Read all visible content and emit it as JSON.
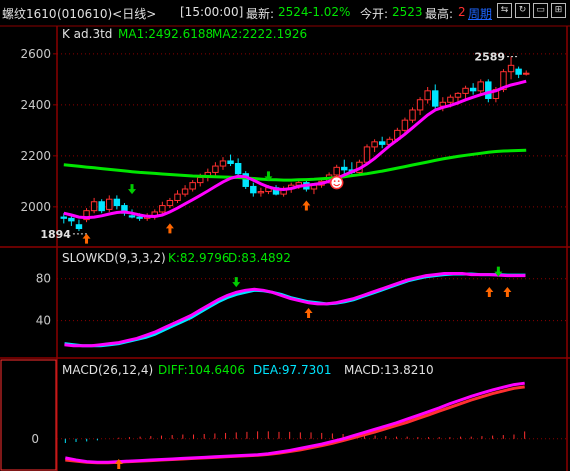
{
  "header": {
    "symbol": "螺纹1610",
    "code_period": "(010610)<日线>",
    "time": "[15:00:00]",
    "latest_label": "最新:",
    "latest_value": "2524",
    "change": "-1.02%",
    "open_label": "今开:",
    "open_value": "2523",
    "high_label": "最高:",
    "high_value": "2",
    "period_link": "周期",
    "nav_buttons": [
      "⇆",
      "↻",
      "▭",
      "⊞"
    ]
  },
  "colors": {
    "background": "#000000",
    "up": "#ff3030",
    "down": "#00e6ff",
    "ma1": "#ff00ff",
    "ma2": "#00e600",
    "slow_line": "#ee1111",
    "grid": "#8b0000",
    "axis_text": "#c8c8c8",
    "signal_up": "#ff6600",
    "signal_down": "#00cc00",
    "neg_value": "#00e600",
    "pos_value": "#ff3030",
    "link": "#1e66ff"
  },
  "chart_data": [
    {
      "type": "candlestick",
      "title": "K  ad.3td",
      "indicators": [
        {
          "label": "MA1:",
          "value": "2492.6188"
        },
        {
          "label": "MA2:",
          "value": "2222.1926"
        }
      ],
      "ylim": [
        1870,
        2670
      ],
      "y_ticks": [
        "2600",
        "2400",
        "2200",
        "2000"
      ],
      "y_tick_values": [
        2600,
        2400,
        2200,
        2000
      ],
      "annotations": [
        {
          "text": "1894",
          "value": 1894
        },
        {
          "text": "2589",
          "value": 2589
        }
      ],
      "candles": [
        [
          1960,
          1975,
          1935,
          1955
        ],
        [
          1955,
          1965,
          1925,
          1945
        ],
        [
          1930,
          1950,
          1905,
          1915
        ],
        [
          1950,
          1995,
          1940,
          1985
        ],
        [
          1985,
          2035,
          1975,
          2020
        ],
        [
          2020,
          2030,
          1975,
          1985
        ],
        [
          1990,
          2045,
          1980,
          2030
        ],
        [
          2030,
          2045,
          1990,
          2005
        ],
        [
          2005,
          2015,
          1965,
          1975
        ],
        [
          1965,
          1990,
          1955,
          1960
        ],
        [
          1960,
          1975,
          1945,
          1955
        ],
        [
          1955,
          1975,
          1945,
          1960
        ],
        [
          1960,
          1990,
          1950,
          1980
        ],
        [
          1980,
          2020,
          1970,
          2005
        ],
        [
          2005,
          2035,
          1995,
          2025
        ],
        [
          2025,
          2065,
          2015,
          2050
        ],
        [
          2050,
          2085,
          2040,
          2070
        ],
        [
          2070,
          2105,
          2060,
          2095
        ],
        [
          2095,
          2130,
          2080,
          2115
        ],
        [
          2115,
          2150,
          2100,
          2135
        ],
        [
          2135,
          2175,
          2120,
          2160
        ],
        [
          2160,
          2195,
          2145,
          2180
        ],
        [
          2180,
          2205,
          2160,
          2170
        ],
        [
          2170,
          2190,
          2120,
          2130
        ],
        [
          2130,
          2140,
          2070,
          2080
        ],
        [
          2080,
          2095,
          2040,
          2055
        ],
        [
          2055,
          2075,
          2040,
          2060
        ],
        [
          2060,
          2085,
          2050,
          2075
        ],
        [
          2075,
          2085,
          2045,
          2050
        ],
        [
          2050,
          2080,
          2040,
          2070
        ],
        [
          2070,
          2095,
          2055,
          2085
        ],
        [
          2085,
          2110,
          2070,
          2095
        ],
        [
          2095,
          2110,
          2060,
          2070
        ],
        [
          2070,
          2090,
          2050,
          2085
        ],
        [
          2085,
          2115,
          2075,
          2100
        ],
        [
          2100,
          2135,
          2090,
          2125
        ],
        [
          2125,
          2165,
          2115,
          2155
        ],
        [
          2155,
          2185,
          2130,
          2145
        ],
        [
          2145,
          2175,
          2120,
          2135
        ],
        [
          2135,
          2185,
          2125,
          2175
        ],
        [
          2175,
          2245,
          2165,
          2235
        ],
        [
          2235,
          2265,
          2215,
          2255
        ],
        [
          2255,
          2275,
          2230,
          2245
        ],
        [
          2245,
          2275,
          2235,
          2265
        ],
        [
          2265,
          2310,
          2255,
          2300
        ],
        [
          2300,
          2350,
          2290,
          2340
        ],
        [
          2340,
          2390,
          2330,
          2380
        ],
        [
          2380,
          2430,
          2360,
          2420
        ],
        [
          2420,
          2470,
          2405,
          2455
        ],
        [
          2455,
          2480,
          2380,
          2395
        ],
        [
          2395,
          2430,
          2375,
          2410
        ],
        [
          2410,
          2440,
          2390,
          2430
        ],
        [
          2430,
          2450,
          2400,
          2445
        ],
        [
          2445,
          2475,
          2425,
          2465
        ],
        [
          2465,
          2485,
          2440,
          2455
        ],
        [
          2455,
          2500,
          2440,
          2490
        ],
        [
          2490,
          2500,
          2410,
          2425
        ],
        [
          2425,
          2470,
          2410,
          2460
        ],
        [
          2460,
          2540,
          2450,
          2530
        ],
        [
          2530,
          2589,
          2500,
          2555
        ],
        [
          2540,
          2550,
          2505,
          2520
        ],
        [
          2523,
          2535,
          2515,
          2524
        ]
      ],
      "ma1": [
        1975,
        1968,
        1960,
        1958,
        1960,
        1965,
        1972,
        1978,
        1980,
        1975,
        1968,
        1963,
        1962,
        1968,
        1980,
        1995,
        2012,
        2028,
        2045,
        2062,
        2080,
        2098,
        2112,
        2120,
        2118,
        2105,
        2090,
        2078,
        2070,
        2068,
        2072,
        2080,
        2085,
        2088,
        2092,
        2100,
        2112,
        2125,
        2138,
        2150,
        2168,
        2190,
        2215,
        2240,
        2262,
        2285,
        2310,
        2335,
        2360,
        2380,
        2390,
        2398,
        2408,
        2420,
        2430,
        2440,
        2448,
        2455,
        2468,
        2478,
        2485,
        2492.6
      ],
      "ma2": [
        2165,
        2162,
        2159,
        2156,
        2153,
        2150,
        2147,
        2144,
        2141,
        2138,
        2135,
        2133,
        2131,
        2129,
        2127,
        2125,
        2123,
        2121,
        2120,
        2119,
        2118,
        2117,
        2116,
        2115,
        2113,
        2111,
        2109,
        2107,
        2106,
        2105,
        2105,
        2106,
        2107,
        2108,
        2110,
        2112,
        2115,
        2118,
        2122,
        2126,
        2130,
        2135,
        2140,
        2146,
        2152,
        2158,
        2164,
        2170,
        2176,
        2182,
        2188,
        2193,
        2198,
        2202,
        2206,
        2210,
        2214,
        2217,
        2219,
        2220,
        2221,
        2222.2
      ]
    },
    {
      "type": "line",
      "title": "SLOWKD(9,3,3,2)",
      "indicators": [
        {
          "label": "K:",
          "value": "82.9796"
        },
        {
          "label": "D:",
          "value": "83.4892"
        }
      ],
      "ylim": [
        10,
        96
      ],
      "y_ticks": [
        "80",
        "40"
      ],
      "y_tick_values": [
        80,
        40
      ],
      "k": [
        17,
        16,
        16,
        16,
        17,
        18,
        19,
        21,
        23,
        26,
        29,
        33,
        37,
        41,
        45,
        50,
        55,
        60,
        64,
        67,
        69,
        70,
        69,
        67,
        64,
        61,
        59,
        57,
        56,
        56,
        57,
        59,
        61,
        64,
        67,
        70,
        73,
        76,
        79,
        81,
        83,
        84,
        85,
        85,
        85,
        84,
        84,
        84,
        83.5,
        83,
        83,
        83
      ],
      "d": [
        18,
        17,
        16,
        16,
        16,
        17,
        18,
        20,
        22,
        24,
        27,
        31,
        35,
        39,
        43,
        48,
        53,
        58,
        62,
        65,
        67,
        69,
        68.5,
        67,
        65,
        62,
        60,
        58,
        57,
        56,
        56.5,
        58,
        60,
        63,
        66,
        69,
        72,
        75,
        78,
        80,
        82,
        83,
        84,
        84.5,
        84.5,
        84.5,
        84,
        84,
        84,
        83.5,
        83.5,
        83.5
      ]
    },
    {
      "type": "line",
      "title": "MACD(26,12,4)",
      "indicators": [
        {
          "label": "DIFF:",
          "value": "104.6406"
        },
        {
          "label": "DEA:",
          "value": "97.7301"
        },
        {
          "label": "MACD:",
          "value": "13.8210"
        }
      ],
      "ylim": [
        -55,
        120
      ],
      "y_ticks": [
        "0"
      ],
      "y_tick_values": [
        0
      ],
      "diff": [
        -36,
        -40,
        -43,
        -44,
        -44,
        -43,
        -42,
        -41,
        -40,
        -39,
        -38,
        -37,
        -36,
        -35,
        -34,
        -33,
        -32,
        -31,
        -30,
        -28,
        -25,
        -22,
        -18,
        -14,
        -10,
        -5,
        0,
        6,
        12,
        18,
        24,
        30,
        37,
        44,
        51,
        58,
        66,
        73,
        80,
        86,
        92,
        97,
        102,
        104.6
      ],
      "dea": [
        -40,
        -42,
        -44,
        -45,
        -45,
        -44,
        -43,
        -42,
        -41,
        -40,
        -39,
        -38,
        -37,
        -36,
        -35,
        -34,
        -33,
        -32,
        -31,
        -29.5,
        -27,
        -24,
        -21,
        -17,
        -13,
        -8.5,
        -3.5,
        2,
        7.5,
        13,
        19,
        25,
        31,
        38,
        45,
        52,
        59,
        66,
        73,
        79,
        85,
        90,
        95,
        97.7
      ],
      "macd": [
        -8,
        -6,
        -5,
        -3,
        0,
        2,
        3,
        4,
        5,
        6,
        7,
        8,
        8,
        9,
        10,
        11,
        12,
        13,
        14,
        14,
        13,
        13,
        12,
        12,
        11,
        10,
        9,
        8,
        7,
        6,
        5,
        4,
        4,
        3,
        3,
        3,
        3,
        4,
        4,
        5,
        6,
        7,
        8,
        13.8
      ]
    }
  ]
}
